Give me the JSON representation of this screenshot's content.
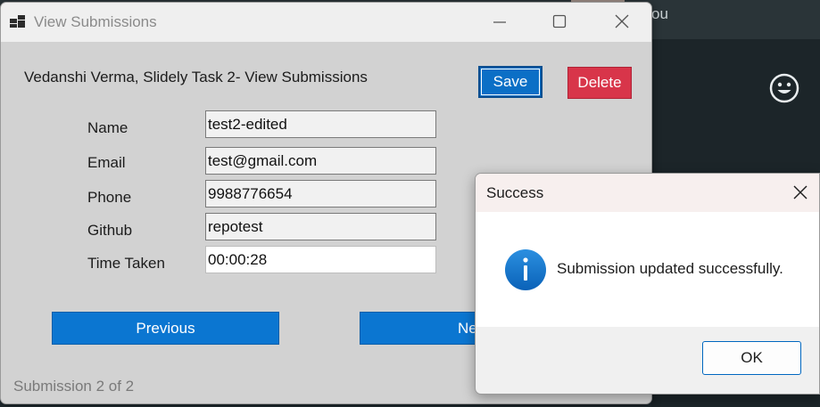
{
  "background": {
    "fragment_text": "ou",
    "icons": {
      "smiley": "smiley-icon"
    }
  },
  "window": {
    "title": "View Submissions",
    "icons": {
      "app": "app-icon",
      "minimize": "minimize-icon",
      "maximize": "maximize-icon",
      "close": "close-icon"
    }
  },
  "main": {
    "heading": "Vedanshi Verma, Slidely Task 2- View Submissions",
    "save_label": "Save",
    "delete_label": "Delete",
    "fields": [
      {
        "label": "Name",
        "value": "test2-edited"
      },
      {
        "label": "Email",
        "value": "test@gmail.com"
      },
      {
        "label": "Phone",
        "value": "9988776654"
      },
      {
        "label": "Github",
        "value": "repotest"
      },
      {
        "label": "Time Taken",
        "value": "00:00:28"
      }
    ],
    "previous_label": "Previous",
    "next_label": "Next",
    "counter": "Submission 2 of 2"
  },
  "dialog": {
    "title": "Success",
    "message": "Submission updated successfully.",
    "ok_label": "OK",
    "icons": {
      "info": "info-icon",
      "close": "close-icon"
    }
  },
  "colors": {
    "accent": "#0b76d1",
    "delete": "#d8354a",
    "window_bg": "#d2d2d2"
  }
}
